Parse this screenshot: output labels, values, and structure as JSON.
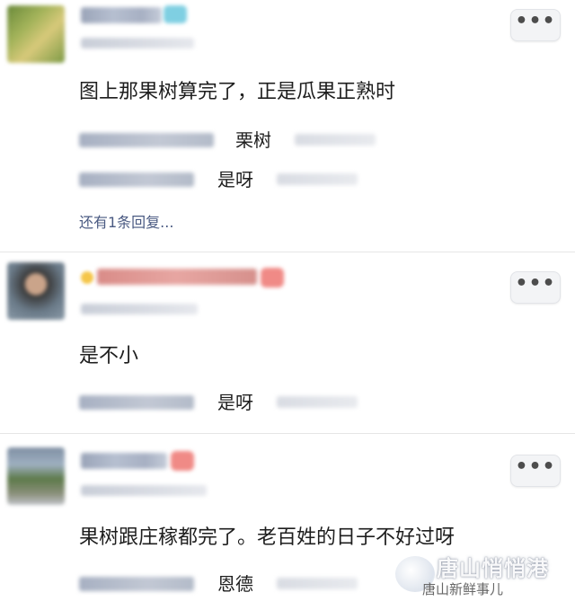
{
  "more_button": {
    "label": "•••"
  },
  "comments": [
    {
      "text": "图上那果树算完了，正是瓜果正熟时",
      "replies": [
        {
          "text": "栗树"
        },
        {
          "text": "是呀"
        }
      ],
      "more_replies": "还有1条回复..."
    },
    {
      "text": "是不小",
      "replies": [
        {
          "text": "是呀"
        }
      ]
    },
    {
      "text": "果树跟庄稼都完了。老百姓的日子不好过呀",
      "replies": [
        {
          "text": "恩德"
        }
      ]
    }
  ],
  "watermark": {
    "title": "唐山悄悄港",
    "subtitle": "唐山新鲜事儿"
  },
  "colors": {
    "link": "#4a5a82",
    "divider": "#e6e6e6",
    "text": "#1e1e1e"
  }
}
